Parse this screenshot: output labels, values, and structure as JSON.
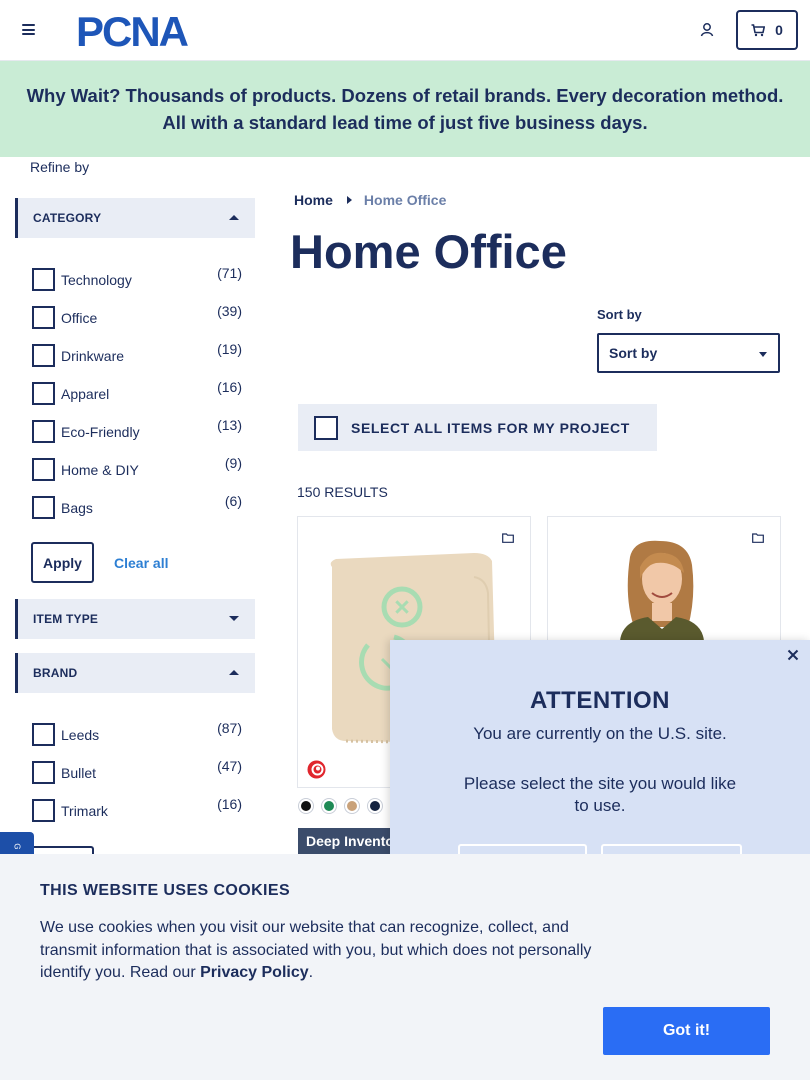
{
  "header": {
    "logo_text": "PCNA",
    "cart_count": "0"
  },
  "banner": {
    "text": "Why Wait? Thousands of products. Dozens of retail brands. Every decoration method. All with a standard lead time of just five business days."
  },
  "sidebar": {
    "refine_label": "Refine by",
    "category": {
      "title": "CATEGORY",
      "items": [
        {
          "label": "Technology",
          "count": "(71)"
        },
        {
          "label": "Office",
          "count": "(39)"
        },
        {
          "label": "Drinkware",
          "count": "(19)"
        },
        {
          "label": "Apparel",
          "count": "(16)"
        },
        {
          "label": "Eco-Friendly",
          "count": "(13)"
        },
        {
          "label": "Home & DIY",
          "count": "(9)"
        },
        {
          "label": "Bags",
          "count": "(6)"
        }
      ]
    },
    "apply_label": "Apply",
    "clear_label": "Clear all",
    "item_type": {
      "title": "ITEM TYPE"
    },
    "brand": {
      "title": "BRAND",
      "items": [
        {
          "label": "Leeds",
          "count": "(87)"
        },
        {
          "label": "Bullet",
          "count": "(47)"
        },
        {
          "label": "Trimark",
          "count": "(16)"
        }
      ]
    }
  },
  "feedback_tab_label": "G",
  "main": {
    "breadcrumb": {
      "home": "Home",
      "current": "Home Office"
    },
    "title": "Home Office",
    "sort": {
      "label": "Sort by",
      "selected": "Sort by"
    },
    "select_all_label": "SELECT ALL ITEMS FOR MY PROJECT",
    "results_label": "150 RESULTS",
    "product1": {
      "swatch_colors": [
        "#111111",
        "#1e8a55",
        "#c9a27a",
        "#14233f"
      ],
      "tag": "Deep Inventory"
    }
  },
  "modal": {
    "title": "ATTENTION",
    "subtitle": "You are currently on the U.S. site.",
    "prompt": "Please select the site you would like to use."
  },
  "cookie": {
    "title": "THIS WEBSITE USES COOKIES",
    "text": "We use cookies when you visit our website that can recognize, collect, and transmit information that is associated with you, but which does not personally identify you. Read our",
    "link": "Privacy Policy",
    "period": ".",
    "button": "Got it!"
  },
  "colors": {
    "navy": "#1c2d5c",
    "banner_bg": "#c9ecd5",
    "accent_blue": "#2a6df4",
    "modal_bg": "#d7e1f5"
  }
}
